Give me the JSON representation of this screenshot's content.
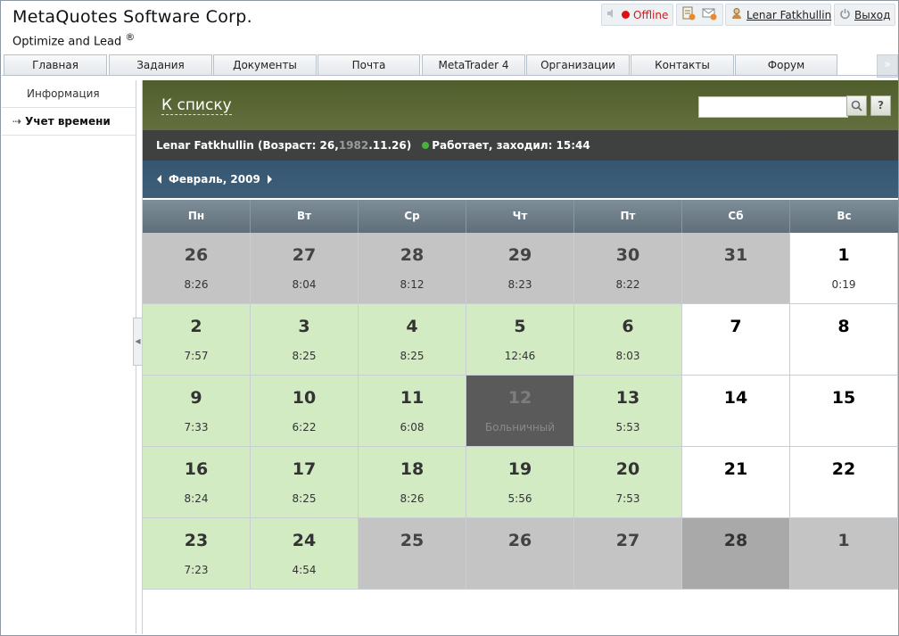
{
  "header": {
    "company": "MetaQuotes Software Corp.",
    "product": "Optimize and Lead",
    "product_mark": "®",
    "status_label": "Offline",
    "user_name": "Lenar Fatkhullin",
    "exit_label": "Выход"
  },
  "nav": {
    "tabs": [
      "Главная",
      "Задания",
      "Документы",
      "Почта",
      "MetaTrader 4",
      "Организации",
      "Контакты",
      "Форум"
    ],
    "more": "»"
  },
  "sidebar": {
    "items": [
      {
        "label": "Информация"
      },
      {
        "label": "Учет времени",
        "arrow": "⇢"
      }
    ]
  },
  "toolbar": {
    "back_label": "К списку",
    "search_placeholder": "",
    "help_label": "?"
  },
  "user_info": {
    "name_age_prefix": "Lenar Fatkhullin (Возраст: 26, ",
    "birth_year": "1982",
    "birth_rest": ".11.26)",
    "status_text": "Работает, заходил: 15:44"
  },
  "month": {
    "label": "Февраль, 2009"
  },
  "calendar": {
    "weekdays": [
      "Пн",
      "Вт",
      "Ср",
      "Чт",
      "Пт",
      "Сб",
      "Вс"
    ],
    "days": [
      {
        "day": "26",
        "hours": "8:26",
        "kind": "gray"
      },
      {
        "day": "27",
        "hours": "8:04",
        "kind": "gray"
      },
      {
        "day": "28",
        "hours": "8:12",
        "kind": "gray"
      },
      {
        "day": "29",
        "hours": "8:23",
        "kind": "gray"
      },
      {
        "day": "30",
        "hours": "8:22",
        "kind": "gray"
      },
      {
        "day": "31",
        "hours": "",
        "kind": "gray"
      },
      {
        "day": "1",
        "hours": "0:19",
        "kind": "white"
      },
      {
        "day": "2",
        "hours": "7:57",
        "kind": "green"
      },
      {
        "day": "3",
        "hours": "8:25",
        "kind": "green"
      },
      {
        "day": "4",
        "hours": "8:25",
        "kind": "green"
      },
      {
        "day": "5",
        "hours": "12:46",
        "kind": "green"
      },
      {
        "day": "6",
        "hours": "8:03",
        "kind": "green"
      },
      {
        "day": "7",
        "hours": "",
        "kind": "white"
      },
      {
        "day": "8",
        "hours": "",
        "kind": "white"
      },
      {
        "day": "9",
        "hours": "7:33",
        "kind": "green"
      },
      {
        "day": "10",
        "hours": "6:22",
        "kind": "green"
      },
      {
        "day": "11",
        "hours": "6:08",
        "kind": "green"
      },
      {
        "day": "12",
        "hours": "Больничный",
        "kind": "dark"
      },
      {
        "day": "13",
        "hours": "5:53",
        "kind": "green"
      },
      {
        "day": "14",
        "hours": "",
        "kind": "white"
      },
      {
        "day": "15",
        "hours": "",
        "kind": "white"
      },
      {
        "day": "16",
        "hours": "8:24",
        "kind": "green"
      },
      {
        "day": "17",
        "hours": "8:25",
        "kind": "green"
      },
      {
        "day": "18",
        "hours": "8:26",
        "kind": "green"
      },
      {
        "day": "19",
        "hours": "5:56",
        "kind": "green"
      },
      {
        "day": "20",
        "hours": "7:53",
        "kind": "green"
      },
      {
        "day": "21",
        "hours": "",
        "kind": "white"
      },
      {
        "day": "22",
        "hours": "",
        "kind": "white"
      },
      {
        "day": "23",
        "hours": "7:23",
        "kind": "green"
      },
      {
        "day": "24",
        "hours": "4:54",
        "kind": "green"
      },
      {
        "day": "25",
        "hours": "",
        "kind": "gray"
      },
      {
        "day": "26",
        "hours": "",
        "kind": "gray"
      },
      {
        "day": "27",
        "hours": "",
        "kind": "gray"
      },
      {
        "day": "28",
        "hours": "",
        "kind": "mid"
      },
      {
        "day": "1",
        "hours": "",
        "kind": "gray"
      }
    ]
  },
  "colors": {
    "offline": "#d01c1c",
    "worked_day": "#d3ebc3",
    "other_month": "#c4c4c4",
    "sick_day": "#5a5a5a",
    "toolbar_olive": "#5a6735",
    "month_bar": "#3a5a74"
  }
}
